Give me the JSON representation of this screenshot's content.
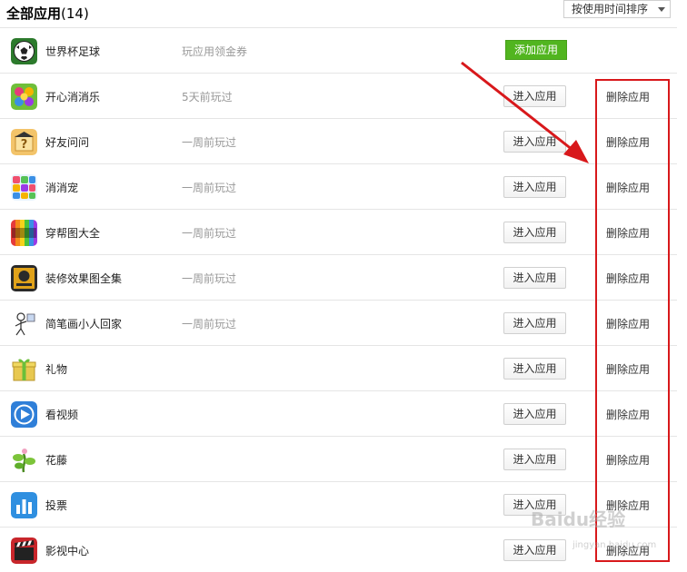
{
  "header": {
    "title": "全部应用",
    "count": "(14)",
    "sort": "按使用时间排序"
  },
  "apps": [
    {
      "name": "世界杯足球",
      "status": "玩应用领金券",
      "action": "添加应用",
      "delete": "",
      "icon": "soccer-ball-icon"
    },
    {
      "name": "开心消消乐",
      "status": "5天前玩过",
      "action": "进入应用",
      "delete": "删除应用",
      "icon": "candy-game-icon"
    },
    {
      "name": "好友问问",
      "status": "一周前玩过",
      "action": "进入应用",
      "delete": "删除应用",
      "icon": "question-icon"
    },
    {
      "name": "消消宠",
      "status": "一周前玩过",
      "action": "进入应用",
      "delete": "删除应用",
      "icon": "pet-match-icon"
    },
    {
      "name": "穿帮图大全",
      "status": "一周前玩过",
      "action": "进入应用",
      "delete": "删除应用",
      "icon": "chuanbang-icon"
    },
    {
      "name": "装修效果图全集",
      "status": "一周前玩过",
      "action": "进入应用",
      "delete": "删除应用",
      "icon": "decoration-icon"
    },
    {
      "name": "简笔画小人回家",
      "status": "一周前玩过",
      "action": "进入应用",
      "delete": "删除应用",
      "icon": "stick-figure-icon"
    },
    {
      "name": "礼物",
      "status": "",
      "action": "进入应用",
      "delete": "删除应用",
      "icon": "gift-icon"
    },
    {
      "name": "看视频",
      "status": "",
      "action": "进入应用",
      "delete": "删除应用",
      "icon": "play-icon"
    },
    {
      "name": "花藤",
      "status": "",
      "action": "进入应用",
      "delete": "删除应用",
      "icon": "vine-icon"
    },
    {
      "name": "投票",
      "status": "",
      "action": "进入应用",
      "delete": "删除应用",
      "icon": "vote-chart-icon"
    },
    {
      "name": "影视中心",
      "status": "",
      "action": "进入应用",
      "delete": "删除应用",
      "icon": "clapperboard-icon"
    }
  ],
  "colors": {
    "add_button": "#51b51f",
    "annotation_red": "#d8181b"
  },
  "watermark": {
    "main": "Baidu经验",
    "sub": "jingyan.baidu.com"
  }
}
